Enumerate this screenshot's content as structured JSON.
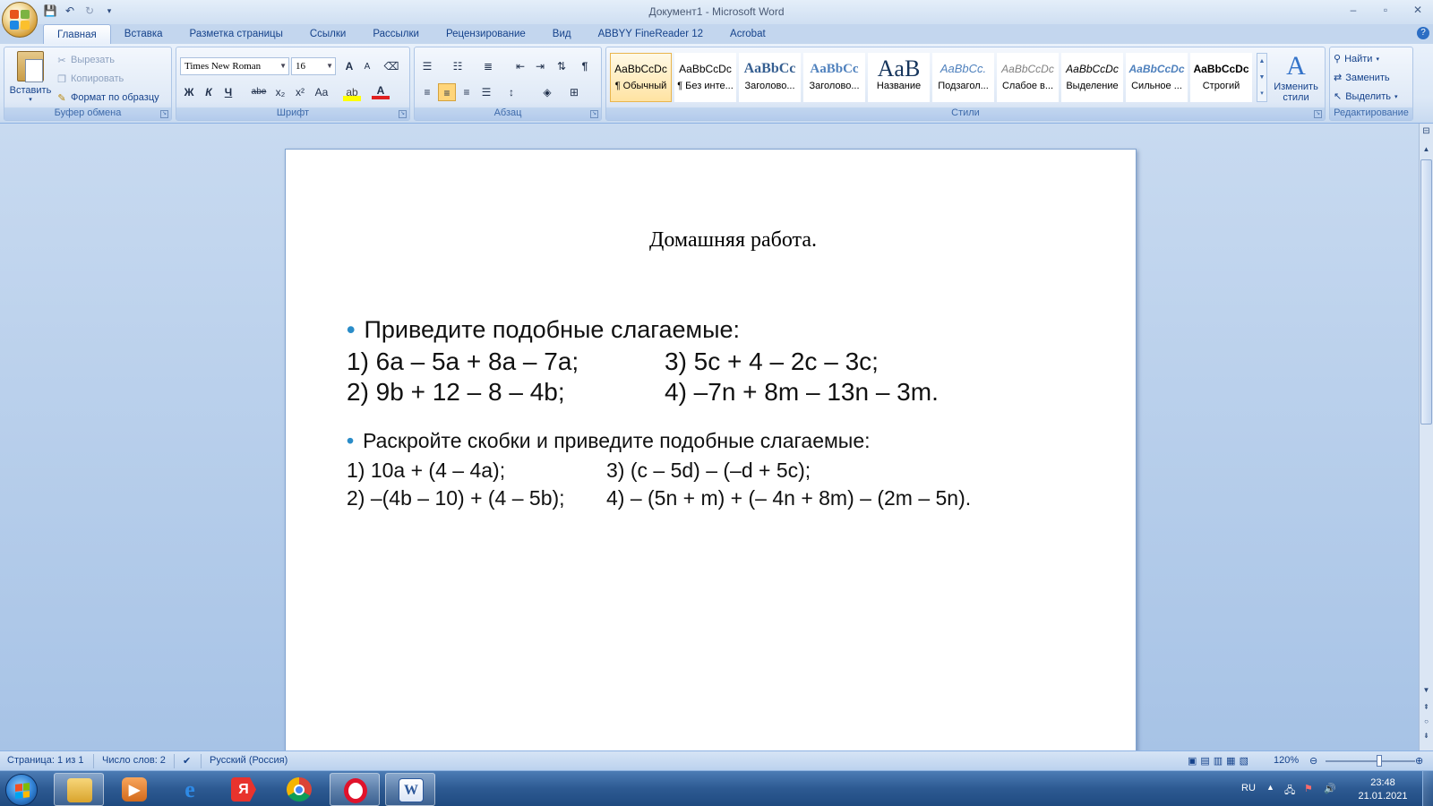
{
  "window": {
    "title": "Документ1 - Microsoft Word",
    "controls": {
      "minimize": "–",
      "maximize": "▫",
      "close": "✕"
    }
  },
  "tabs": [
    "Главная",
    "Вставка",
    "Разметка страницы",
    "Ссылки",
    "Рассылки",
    "Рецензирование",
    "Вид",
    "ABBYY FineReader 12",
    "Acrobat"
  ],
  "ribbon": {
    "clipboard": {
      "paste": "Вставить",
      "cut": "Вырезать",
      "copy": "Копировать",
      "format_painter": "Формат по образцу",
      "label": "Буфер обмена"
    },
    "font": {
      "name": "Times New Roman",
      "size": "16",
      "label": "Шрифт",
      "bold": "Ж",
      "italic": "К",
      "underline": "Ч",
      "strike": "abe",
      "sub": "x₂",
      "sup": "x²",
      "case": "Aa",
      "grow": "A",
      "shrink": "A"
    },
    "paragraph": {
      "label": "Абзац",
      "pilcrow": "¶"
    },
    "styles": {
      "label": "Стили",
      "items": [
        {
          "sample": "AaBbCcDc",
          "name": "¶ Обычный"
        },
        {
          "sample": "AaBbCcDc",
          "name": "¶ Без инте..."
        },
        {
          "sample": "AaBbCc",
          "name": "Заголово..."
        },
        {
          "sample": "AaBbCc",
          "name": "Заголово..."
        },
        {
          "sample": "AaB",
          "name": "Название"
        },
        {
          "sample": "AaBbCc.",
          "name": "Подзагол..."
        },
        {
          "sample": "AaBbCcDc",
          "name": "Слабое в..."
        },
        {
          "sample": "AaBbCcDc",
          "name": "Выделение"
        },
        {
          "sample": "AaBbCcDc",
          "name": "Сильное ..."
        },
        {
          "sample": "AaBbCcDc",
          "name": "Строгий"
        }
      ],
      "change": "Изменить стили"
    },
    "editing": {
      "label": "Редактирование",
      "find": "Найти",
      "replace": "Заменить",
      "select": "Выделить"
    }
  },
  "document": {
    "title": "Домашняя работа.",
    "task1": {
      "heading": "Приведите подобные слагаемые:",
      "r1c1": "1) 6a – 5a + 8a – 7a;",
      "r1c2": "3) 5c + 4 – 2c – 3c;",
      "r2c1": "2) 9b + 12 – 8 – 4b;",
      "r2c2": "4) –7n + 8m – 13n – 3m."
    },
    "task2": {
      "heading": "Раскройте скобки и приведите подобные слагаемые:",
      "r1c1": "1) 10a + (4 – 4a);",
      "r1c2": "3) (c – 5d) – (–d + 5c);",
      "r2c1": "2) –(4b – 10) + (4 – 5b);",
      "r2c2": "4) – (5n + m) + (– 4n + 8m) – (2m – 5n)."
    }
  },
  "statusbar": {
    "page": "Страница: 1 из 1",
    "words": "Число слов: 2",
    "language": "Русский (Россия)",
    "zoom": "120%",
    "zoom_level": 0.6
  },
  "taskbar": {
    "lang": "RU",
    "time": "23:48",
    "date": "21.01.2021"
  },
  "colors": {
    "accent": "#2b579a",
    "taskbar": "#2d5a92",
    "bullet": "#2a8cc8"
  }
}
